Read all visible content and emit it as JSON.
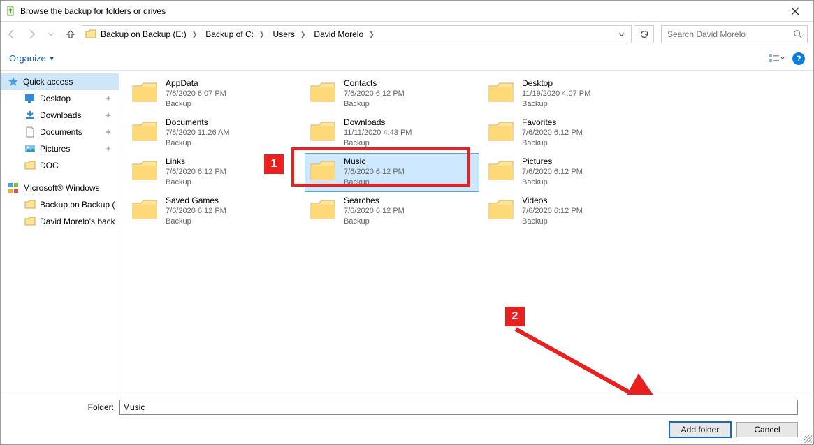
{
  "window": {
    "title": "Browse the backup for folders or drives"
  },
  "breadcrumbs": {
    "b0": "Backup on Backup (E:)",
    "b1": "Backup of C:",
    "b2": "Users",
    "b3": "David Morelo"
  },
  "search": {
    "placeholder": "Search David Morelo"
  },
  "toolbar": {
    "organize": "Organize"
  },
  "sidebar": {
    "quick_access": "Quick access",
    "desktop": "Desktop",
    "downloads": "Downloads",
    "documents": "Documents",
    "pictures": "Pictures",
    "doc": "DOC",
    "ms_windows": "Microsoft® Windows",
    "backup_on_backup": "Backup on Backup (",
    "david_backup": "David Morelo's back"
  },
  "kind_label": "Backup",
  "items": [
    {
      "name": "AppData",
      "date": "7/6/2020 6:07 PM"
    },
    {
      "name": "Contacts",
      "date": "7/6/2020 6:12 PM"
    },
    {
      "name": "Desktop",
      "date": "11/19/2020 4:07 PM"
    },
    {
      "name": "Documents",
      "date": "7/8/2020 11:26 AM"
    },
    {
      "name": "Downloads",
      "date": "11/11/2020 4:43 PM"
    },
    {
      "name": "Favorites",
      "date": "7/6/2020 6:12 PM"
    },
    {
      "name": "Links",
      "date": "7/6/2020 6:12 PM"
    },
    {
      "name": "Music",
      "date": "7/6/2020 6:12 PM"
    },
    {
      "name": "Pictures",
      "date": "7/6/2020 6:12 PM"
    },
    {
      "name": "Saved Games",
      "date": "7/6/2020 6:12 PM"
    },
    {
      "name": "Searches",
      "date": "7/6/2020 6:12 PM"
    },
    {
      "name": "Videos",
      "date": "7/6/2020 6:12 PM"
    }
  ],
  "folder_label": "Folder:",
  "folder_value": "Music",
  "buttons": {
    "add": "Add folder",
    "cancel": "Cancel"
  },
  "annotations": {
    "badge1": "1",
    "badge2": "2"
  }
}
